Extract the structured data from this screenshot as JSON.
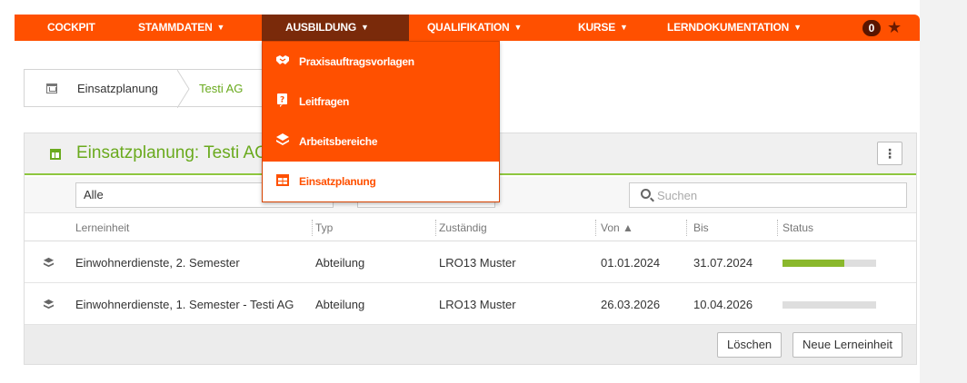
{
  "nav": {
    "items": [
      {
        "label": "COCKPIT",
        "arrow": ""
      },
      {
        "label": "STAMMDATEN",
        "arrow": "▼"
      },
      {
        "label": "AUSBILDUNG",
        "arrow": "▼"
      },
      {
        "label": "QUALIFIKATION",
        "arrow": "▼"
      },
      {
        "label": "KURSE",
        "arrow": "▼"
      },
      {
        "label": "LERNDOKUMENTATION",
        "arrow": "▼"
      }
    ],
    "badge": "0",
    "star": "★",
    "accent": "#ff5000"
  },
  "dropdown": {
    "items": [
      {
        "label": "Praxisauftragsvorlagen",
        "icon": "handshake-icon"
      },
      {
        "label": "Leitfragen",
        "icon": "question-icon"
      },
      {
        "label": "Arbeitsbereiche",
        "icon": "layers-icon"
      },
      {
        "label": "Einsatzplanung",
        "icon": "calendar-icon"
      }
    ]
  },
  "breadcrumb": {
    "items": [
      "Einsatzplanung",
      "Testi AG"
    ]
  },
  "panel": {
    "title": "Einsatzplanung: Testi AG",
    "kebab": "⋮",
    "filter_value": "Alle",
    "search_placeholder": "Suchen",
    "columns": {
      "lerneinheit": "Lerneinheit",
      "typ": "Typ",
      "zustaendig": "Zuständig",
      "von": "Von ▲",
      "bis": "Bis",
      "status": "Status"
    },
    "rows": [
      {
        "lerneinheit": "Einwohnerdienste, 2. Semester",
        "typ": "Abteilung",
        "zustaendig": "LRO13 Muster",
        "von": "01.01.2024",
        "bis": "31.07.2024",
        "progress": 0.66
      },
      {
        "lerneinheit": "Einwohnerdienste, 1. Semester - Testi AG",
        "typ": "Abteilung",
        "zustaendig": "LRO13 Muster",
        "von": "26.03.2026",
        "bis": "10.04.2026",
        "progress": 0.0
      }
    ],
    "buttons": {
      "delete": "Löschen",
      "new": "Neue Lerneinheit"
    }
  }
}
